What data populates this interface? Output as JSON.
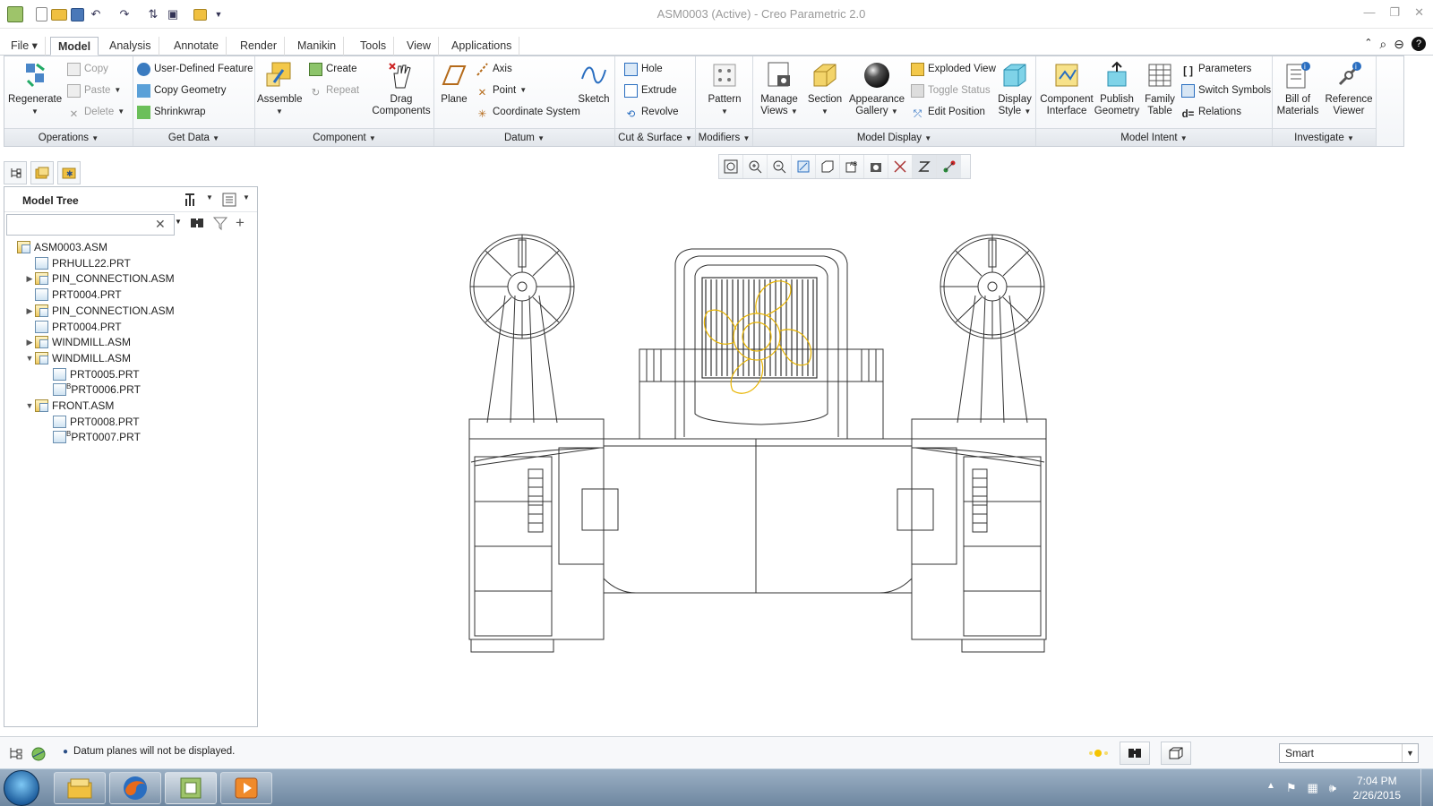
{
  "window": {
    "title": "ASM0003 (Active) - Creo Parametric 2.0",
    "controls": [
      "minimize-icon",
      "restore-icon",
      "close-icon"
    ]
  },
  "quick_access": [
    "app-icon",
    "new-icon",
    "open-icon",
    "save-icon",
    "undo-icon",
    "redo-icon",
    "regenerate-icon",
    "windows-icon",
    "close-window-icon",
    "customize-icon"
  ],
  "ribbon_tabs": [
    {
      "label": "File ▾",
      "active": false
    },
    {
      "label": "Model",
      "active": true
    },
    {
      "label": "Analysis",
      "active": false
    },
    {
      "label": "Annotate",
      "active": false
    },
    {
      "label": "Render",
      "active": false
    },
    {
      "label": "Manikin",
      "active": false
    },
    {
      "label": "Tools",
      "active": false
    },
    {
      "label": "View",
      "active": false
    },
    {
      "label": "Applications",
      "active": false
    }
  ],
  "groups": {
    "operations": {
      "label": "Operations",
      "regenerate": "Regenerate",
      "copy": "Copy",
      "paste": "Paste",
      "delete": "Delete"
    },
    "get_data": {
      "label": "Get Data",
      "udf": "User-Defined Feature",
      "copy_geometry": "Copy Geometry",
      "shrinkwrap": "Shrinkwrap"
    },
    "component": {
      "label": "Component",
      "assemble": "Assemble",
      "create": "Create",
      "repeat": "Repeat",
      "drag_line1": "Drag",
      "drag_line2": "Components"
    },
    "datum": {
      "label": "Datum",
      "plane": "Plane",
      "axis": "Axis",
      "point": "Point",
      "csys": "Coordinate System",
      "sketch": "Sketch"
    },
    "cut_surface": {
      "label": "Cut & Surface",
      "hole": "Hole",
      "extrude": "Extrude",
      "revolve": "Revolve"
    },
    "modifiers": {
      "label": "Modifiers",
      "pattern": "Pattern"
    },
    "model_display": {
      "label": "Model Display",
      "manage_views_1": "Manage",
      "manage_views_2": "Views",
      "section": "Section",
      "appearance_1": "Appearance",
      "appearance_2": "Gallery",
      "exploded": "Exploded View",
      "toggle_status": "Toggle Status",
      "edit_position": "Edit Position",
      "display_1": "Display",
      "display_2": "Style"
    },
    "model_intent": {
      "label": "Model Intent",
      "comp_int_1": "Component",
      "comp_int_2": "Interface",
      "publish_1": "Publish",
      "publish_2": "Geometry",
      "family_1": "Family",
      "family_2": "Table",
      "parameters": "Parameters",
      "switch_symbols": "Switch Symbols",
      "relations": "Relations"
    },
    "investigate": {
      "label": "Investigate",
      "bom_1": "Bill of",
      "bom_2": "Materials",
      "ref_1": "Reference",
      "ref_2": "Viewer"
    }
  },
  "model_tree": {
    "title": "Model Tree",
    "search_value": "",
    "items": [
      {
        "label": "ASM0003.ASM",
        "type": "asm",
        "level": 0,
        "expander": ""
      },
      {
        "label": "PRHULL22.PRT",
        "type": "prt",
        "level": 1,
        "expander": ""
      },
      {
        "label": "PIN_CONNECTION.ASM",
        "type": "asm",
        "level": 1,
        "expander": "▶"
      },
      {
        "label": "PRT0004.PRT",
        "type": "prt",
        "level": 1,
        "expander": ""
      },
      {
        "label": "PIN_CONNECTION.ASM",
        "type": "asm",
        "level": 1,
        "expander": "▶"
      },
      {
        "label": "PRT0004.PRT",
        "type": "prt",
        "level": 1,
        "expander": ""
      },
      {
        "label": "WINDMILL.ASM",
        "type": "asm",
        "level": 1,
        "expander": "▶"
      },
      {
        "label": "WINDMILL.ASM",
        "type": "asm",
        "level": 1,
        "expander": "▼"
      },
      {
        "label": "PRT0005.PRT",
        "type": "prt",
        "level": 2,
        "expander": ""
      },
      {
        "label": "PRT0006.PRT",
        "type": "prt",
        "level": 2,
        "expander": "",
        "flag": "B"
      },
      {
        "label": "FRONT.ASM",
        "type": "asm",
        "level": 1,
        "expander": "▼"
      },
      {
        "label": "PRT0008.PRT",
        "type": "prt",
        "level": 2,
        "expander": ""
      },
      {
        "label": "PRT0007.PRT",
        "type": "prt",
        "level": 2,
        "expander": "",
        "flag": "B"
      }
    ]
  },
  "view_toolbar": [
    "refit-icon",
    "zoom-in-icon",
    "zoom-out-icon",
    "repaint-icon",
    "display-style-icon",
    "saved-views-icon",
    "view-manager-icon",
    "datum-display-icon",
    "spin-center-icon",
    "annotation-display-icon"
  ],
  "status": {
    "message": "Datum planes will not be displayed.",
    "filter_value": "Smart"
  },
  "taskbar": {
    "time": "7:04 PM",
    "date": "2/26/2015",
    "apps": [
      "explorer-icon",
      "firefox-icon",
      "creo-icon",
      "media-player-icon"
    ]
  },
  "colors": {
    "accent": "#f5c400",
    "highlight": "#e8b400",
    "wire": "#333333"
  }
}
